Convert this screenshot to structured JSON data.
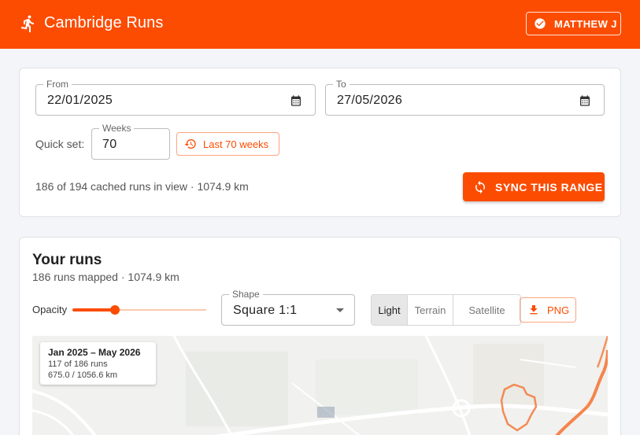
{
  "app": {
    "title": "Cambridge Runs",
    "user_label": "MATTHEW J"
  },
  "range": {
    "from_label": "From",
    "from_value": "22/01/2025",
    "to_label": "To",
    "to_value": "27/05/2026",
    "quick_set_label": "Quick set:",
    "weeks_label": "Weeks",
    "weeks_value": "70",
    "last_button": "Last 70 weeks",
    "stats": "186 of 194 cached runs in view · 1074.9 km",
    "sync_button": "SYNC THIS RANGE"
  },
  "runs": {
    "title": "Your runs",
    "subtitle": "186 runs mapped · 1074.9 km",
    "opacity_label": "Opacity",
    "opacity_value": 0.32,
    "shape_label": "Shape",
    "shape_value": "Square 1:1",
    "map_styles": [
      "Light",
      "Terrain",
      "Satellite"
    ],
    "active_style": "Light",
    "png_button": "PNG",
    "map_info": {
      "title": "Jan 2025 – May 2026",
      "runs_line": "117 of 186 runs",
      "km_line": "675.0 / 1056.6 km"
    }
  },
  "colors": {
    "accent": "#fc4c02",
    "route": "#f5793a"
  },
  "icons": [
    "runner-icon",
    "check-circle-icon",
    "calendar-icon",
    "history-icon",
    "sync-icon",
    "caret-down-icon",
    "download-icon"
  ]
}
